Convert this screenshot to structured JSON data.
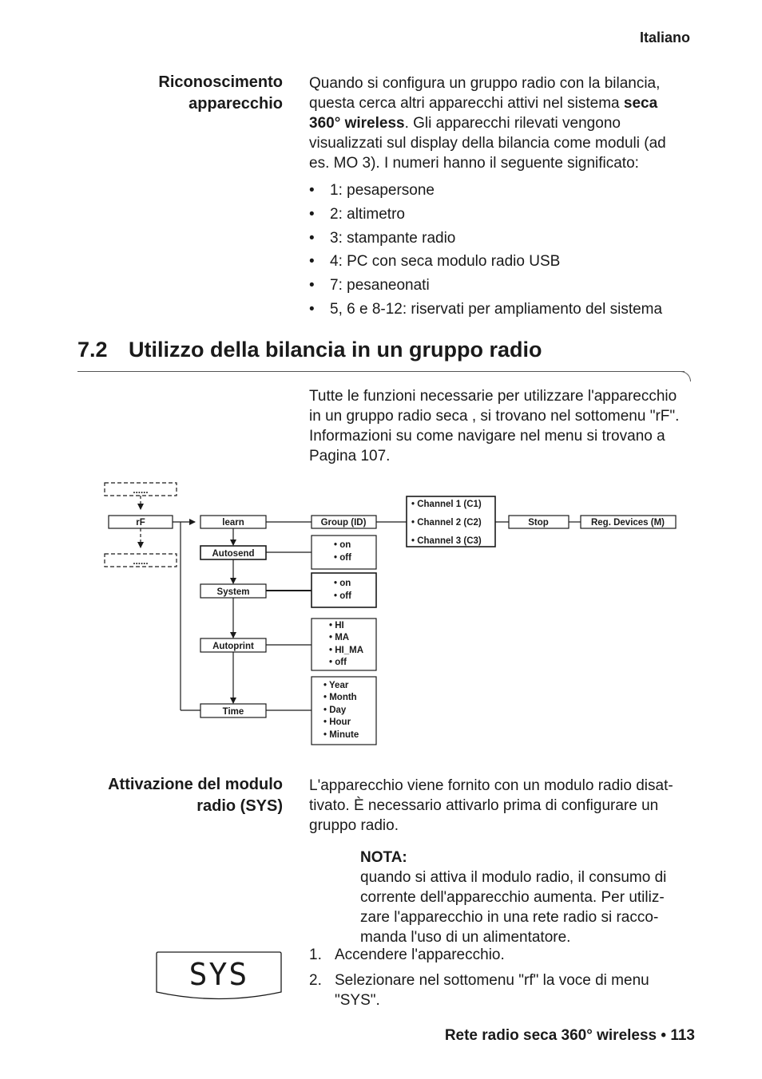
{
  "header": {
    "language": "Italiano"
  },
  "section_recognition": {
    "heading_line1": "Riconoscimento",
    "heading_line2": "apparecchio",
    "para_part1": "Quando si configura un gruppo radio con la bilancia, questa cerca altri apparecchi attivi nel sistema ",
    "para_bold": "seca 360° wireless",
    "para_part2": ". Gli apparecchi rilevati vengono visualizzati sul display della bilancia come moduli (ad es. MO 3). I numeri hanno il seguente significato:",
    "bullets": [
      "1: pesapersone",
      "2: altimetro",
      "3: stampante radio",
      "4: PC con seca modulo radio USB",
      "7: pesaneonati",
      "5, 6 e 8-12: riservati per ampliamento del sistema"
    ]
  },
  "chapter": {
    "number": "7.2",
    "title": "Utilizzo della bilancia in un gruppo radio",
    "intro": "Tutte le funzioni necessarie per utilizzare l'apparecchio in un gruppo radio seca , si trovano nel sottomenu \"rF\". Informazioni su come navigare nel menu si trovano a Pagina 107."
  },
  "diagram": {
    "ellipsis": "......",
    "rf": "rF",
    "learn": "learn",
    "group": "Group (ID)",
    "channels": [
      "• Channel 1 (C1)",
      "• Channel 2 (C2)",
      "• Channel 3 (C3)"
    ],
    "stop": "Stop",
    "reg_devices": "Reg. Devices (M)",
    "autosend": "Autosend",
    "autosend_options": [
      "• on",
      "• off"
    ],
    "system": "System",
    "system_options": [
      "• on",
      "• off"
    ],
    "autoprint": "Autoprint",
    "autoprint_options": [
      "• HI",
      "• MA",
      "• HI_MA",
      "• off"
    ],
    "time": "Time",
    "time_options": [
      "• Year",
      "• Month",
      "• Day",
      "• Hour",
      "• Minute"
    ]
  },
  "section_activation": {
    "heading_line1": "Attivazione del modulo",
    "heading_line2": "radio (SYS)",
    "para": "L'apparecchio viene fornito con un modulo radio disat-tivato. È necessario attivarlo prima di configurare un gruppo radio.",
    "note_title": "NOTA:",
    "note_text": "quando si attiva il modulo radio, il consumo di corrente dell'apparecchio aumenta. Per utiliz-zare l'apparecchio in una rete radio si racco-manda l'uso di un alimentatore.",
    "display_text": "SYS",
    "steps": [
      {
        "num": "1.",
        "text": "Accendere l'apparecchio."
      },
      {
        "num": "2.",
        "text": "Selezionare nel sottomenu \"rf\" la voce di menu \"SYS\"."
      }
    ]
  },
  "footer": {
    "text": "Rete radio seca 360° wireless • 113"
  }
}
